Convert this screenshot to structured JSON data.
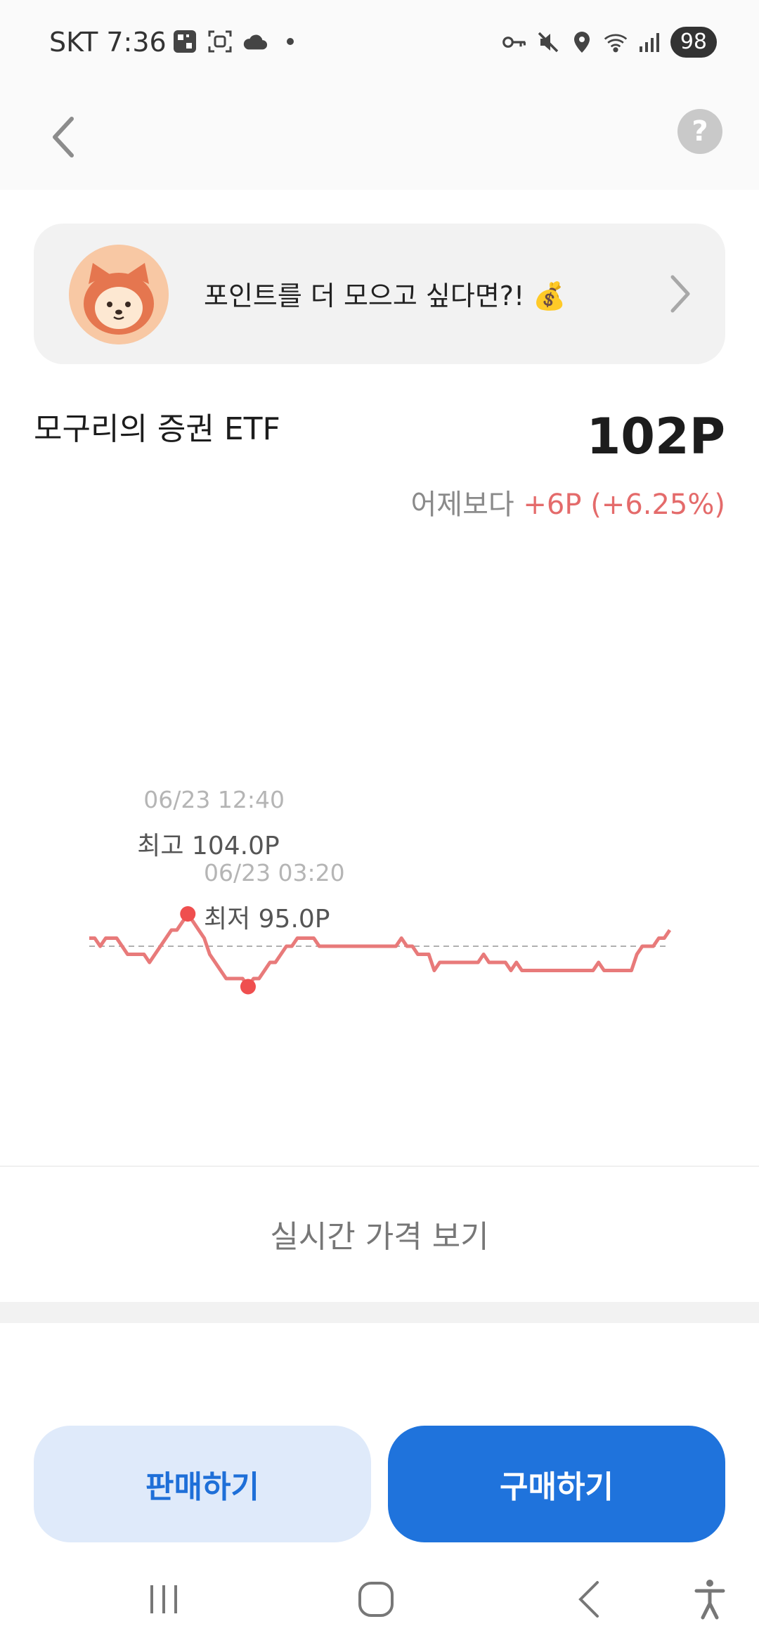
{
  "status_bar": {
    "carrier_time": "SKT 7:36",
    "battery": "98",
    "left_icons": [
      "qr-app-icon",
      "scan-icon",
      "cloud-icon",
      "dot-icon"
    ],
    "right_icons": [
      "key-icon",
      "mute-icon",
      "location-icon",
      "wifi-icon",
      "signal-icon"
    ]
  },
  "promo": {
    "text": "포인트를 더 모으고 싶다면?! 💰"
  },
  "fund": {
    "name": "모구리의 증권 ETF",
    "price": "102P",
    "change_prefix": "어제보다",
    "change_value": "+6P (+6.25%)"
  },
  "chart_data": {
    "type": "line",
    "baseline": 100,
    "values": [
      101,
      101,
      100,
      101,
      101,
      101,
      100,
      99,
      99,
      99,
      99,
      98,
      99,
      100,
      101,
      102,
      102,
      103,
      104,
      103,
      102,
      101,
      99,
      98,
      97,
      96,
      96,
      96,
      96,
      95,
      96,
      96,
      97,
      98,
      98,
      99,
      100,
      100,
      101,
      101,
      101,
      101,
      100,
      100,
      100,
      100,
      100,
      100,
      100,
      100,
      100,
      100,
      100,
      100,
      100,
      100,
      100,
      101,
      100,
      100,
      99,
      99,
      99,
      97,
      98,
      98,
      98,
      98,
      98,
      98,
      98,
      98,
      99,
      98,
      98,
      98,
      98,
      97,
      98,
      97,
      97,
      97,
      97,
      97,
      97,
      97,
      97,
      97,
      97,
      97,
      97,
      97,
      97,
      98,
      97,
      97,
      97,
      97,
      97,
      97,
      99,
      100,
      100,
      100,
      101,
      101,
      102
    ],
    "high": {
      "label": "최고 104.0P",
      "date": "06/23 12:40",
      "index": 18
    },
    "low": {
      "label": "최저 95.0P",
      "date": "06/23 03:20",
      "index": 29
    },
    "color": "#e87a7a",
    "point_color": "#ef4f4f"
  },
  "realtime": {
    "label": "실시간 가격 보기"
  },
  "actions": {
    "sell_label": "판매하기",
    "buy_label": "구매하기"
  }
}
